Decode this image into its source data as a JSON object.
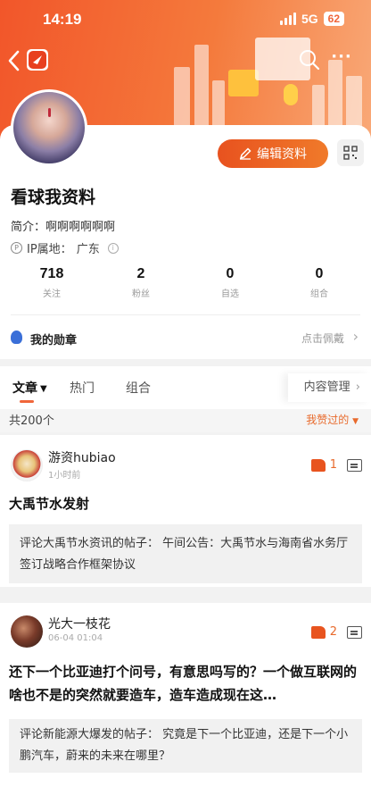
{
  "status_bar": {
    "time": "14:19",
    "network": "5G",
    "battery": "62"
  },
  "nav": {
    "back_icon": "back-chevron-icon",
    "logo_icon": "app-logo-icon",
    "search_icon": "search-icon",
    "more_icon": "more-dots-icon"
  },
  "profile": {
    "edit_label": "编辑资料",
    "username": "看球我资料",
    "bio": "简介：啊啊啊啊啊啊",
    "ip_label": "IP属地：",
    "ip_value": "广东",
    "stats": [
      {
        "value": "718",
        "label": "关注"
      },
      {
        "value": "2",
        "label": "粉丝"
      },
      {
        "value": "0",
        "label": "自选"
      },
      {
        "value": "0",
        "label": "组合"
      }
    ],
    "medal_label": "我的勋章",
    "medal_action": "点击佩戴"
  },
  "tabs": {
    "items": [
      {
        "label": "文章"
      },
      {
        "label": "热门"
      },
      {
        "label": "组合"
      }
    ],
    "content_mgmt": "内容管理",
    "accent": "#f0663a"
  },
  "list": {
    "count": "共200个",
    "filter": "我赞过的"
  },
  "posts": [
    {
      "author": "游资hubiao",
      "time": "1小时前",
      "likes": "1",
      "title": "大禹节水发射",
      "quote": "评论大禹节水资讯的帖子： 午间公告：大禹节水与海南省水务厅签订战略合作框架协议"
    },
    {
      "author": "光大一枝花",
      "time": "06-04 01:04",
      "likes": "2",
      "title": "还下一个比亚迪打个问号，有意思吗写的？一个做互联网的啥也不是的突然就要造车，造车造成现在这…",
      "quote": "评论新能源大爆发的帖子： 究竟是下一个比亚迪，还是下一个小鹏汽车，蔚来的未来在哪里？"
    }
  ]
}
